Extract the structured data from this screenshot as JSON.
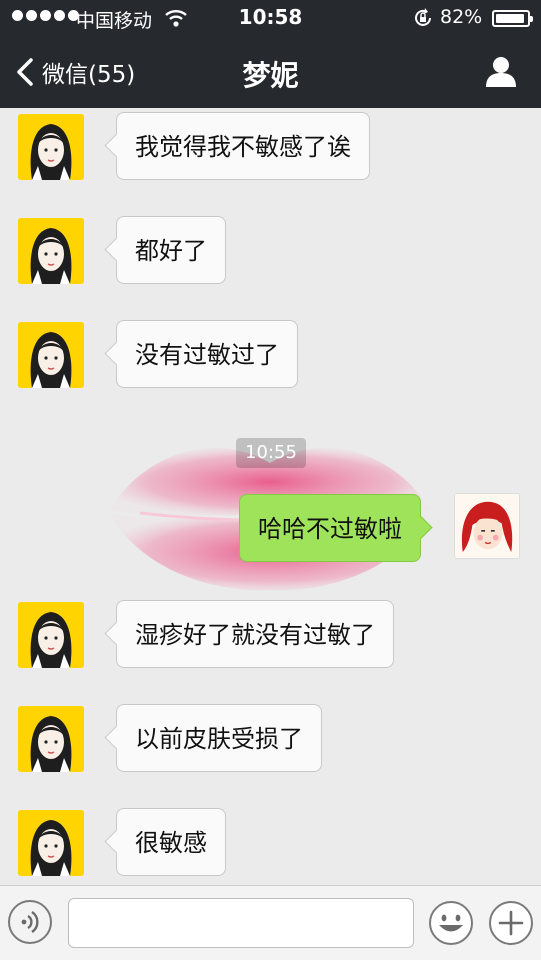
{
  "status_bar": {
    "carrier": "中国移动",
    "time": "10:58",
    "battery": "82%",
    "battery_level": 0.82
  },
  "nav": {
    "back_label": "微信(55)",
    "title": "梦妮",
    "back_icon": "chevron-left-icon",
    "profile_icon": "person-icon"
  },
  "messages": [
    {
      "side": "in",
      "text": "我觉得我不敏感了诶"
    },
    {
      "side": "in",
      "text": "都好了"
    },
    {
      "side": "in",
      "text": "没有过敏过了"
    },
    {
      "side": "out",
      "text": "哈哈不过敏啦"
    },
    {
      "side": "in",
      "text": "湿疹好了就没有过敏了"
    },
    {
      "side": "in",
      "text": "以前皮肤受损了"
    },
    {
      "side": "in",
      "text": "很敏感"
    }
  ],
  "timestamp": "10:55",
  "input": {
    "value": "",
    "placeholder": ""
  },
  "colors": {
    "nav_bg": "#262a2f",
    "chat_bg": "#ebebeb",
    "outgoing_bubble": "#9fe35a",
    "incoming_bubble": "#fafafa"
  }
}
